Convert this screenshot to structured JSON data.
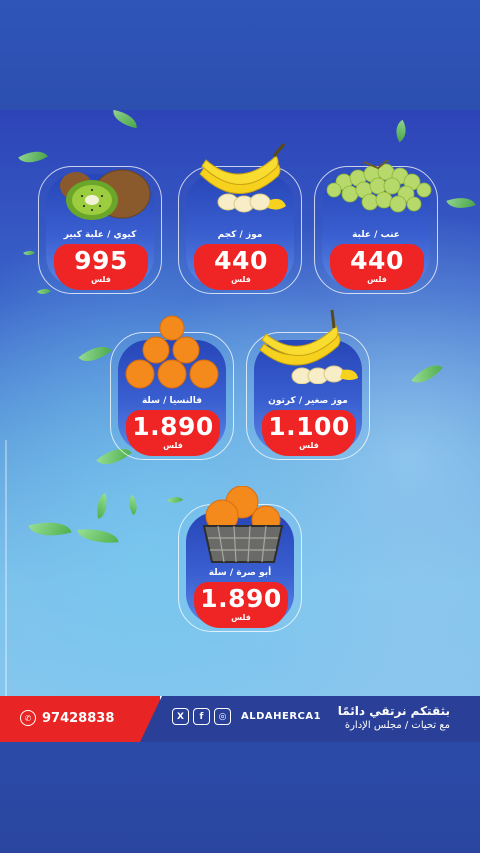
{
  "products": [
    {
      "id": "grapes",
      "label": "عنب / علبة",
      "price": "440",
      "currency": "فلس",
      "image": "grapes"
    },
    {
      "id": "bananas",
      "label": "موز / كجم",
      "price": "440",
      "currency": "فلس",
      "image": "bananas"
    },
    {
      "id": "kiwi",
      "label": "كيوي / علبة كبير",
      "price": "995",
      "currency": "فلس",
      "image": "kiwi"
    },
    {
      "id": "small-bananas",
      "label": "موز صغير / كرتون",
      "price": "1.100",
      "currency": "فلس",
      "image": "bananas"
    },
    {
      "id": "valencia",
      "label": "فالنسيا / سلة",
      "price": "1.890",
      "currency": "فلس",
      "image": "oranges-pyramid"
    },
    {
      "id": "navel-orange",
      "label": "أبو صرة / سلة",
      "price": "1.890",
      "currency": "فلس",
      "image": "oranges-basket"
    }
  ],
  "footer": {
    "phone": "97428838",
    "handle": "ALDAHERCA1",
    "slogan_line1": "بثقتكم نرتقي دائمًا",
    "slogan_line2": "مع تحيات / مجلس الإدارة",
    "social_icons": [
      "x-icon",
      "facebook-icon",
      "instagram-icon"
    ],
    "phone_icon": "whatsapp-icon"
  },
  "colors": {
    "price_red": "#ee2524",
    "footer_blue": "#2a3f98",
    "footer_red": "#e82424"
  }
}
